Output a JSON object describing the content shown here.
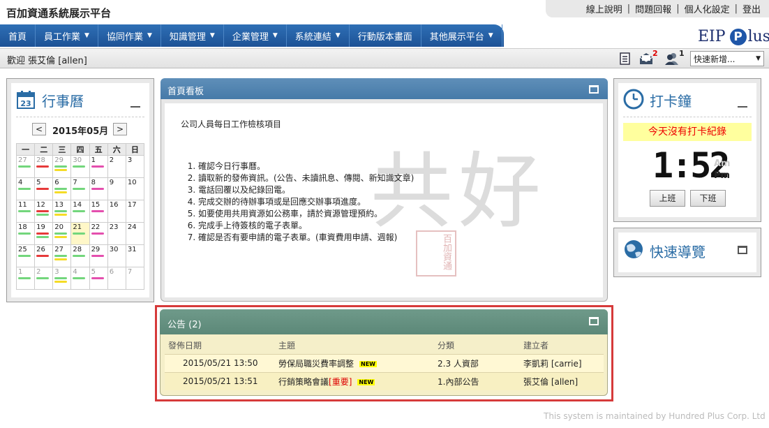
{
  "header": {
    "brand": "百加資通系統展示平台",
    "links": [
      "線上說明",
      "問題回報",
      "個人化設定",
      "登出"
    ]
  },
  "nav": [
    {
      "label": "首頁",
      "dropdown": false
    },
    {
      "label": "員工作業",
      "dropdown": true
    },
    {
      "label": "協同作業",
      "dropdown": true
    },
    {
      "label": "知識管理",
      "dropdown": true
    },
    {
      "label": "企業管理",
      "dropdown": true
    },
    {
      "label": "系統連結",
      "dropdown": true
    },
    {
      "label": "行動版本畫面",
      "dropdown": false
    },
    {
      "label": "其他展示平台",
      "dropdown": true
    }
  ],
  "logo": {
    "left": "EIP",
    "mid": "P",
    "right": "lus"
  },
  "toolbar": {
    "welcome": "歡迎 張艾倫 [allen]",
    "mail_count": "2",
    "user_count": "1",
    "quick_add": "快速新增...",
    "quick_caret": "▼"
  },
  "calendar": {
    "title": "行事曆",
    "month": "2015年05月",
    "prev": "<",
    "next": ">",
    "weekdays": [
      "一",
      "二",
      "三",
      "四",
      "五",
      "六",
      "日"
    ],
    "weeks": [
      [
        {
          "d": "27",
          "o": true,
          "b": [
            "g"
          ]
        },
        {
          "d": "28",
          "o": true,
          "b": [
            "r"
          ]
        },
        {
          "d": "29",
          "o": true,
          "b": [
            "g",
            "y"
          ]
        },
        {
          "d": "30",
          "o": true,
          "b": [
            "g"
          ]
        },
        {
          "d": "1",
          "b": [
            "m"
          ]
        },
        {
          "d": "2",
          "b": []
        },
        {
          "d": "3",
          "b": []
        }
      ],
      [
        {
          "d": "4",
          "b": [
            "g"
          ]
        },
        {
          "d": "5",
          "b": [
            "r"
          ]
        },
        {
          "d": "6",
          "b": [
            "g",
            "y"
          ]
        },
        {
          "d": "7",
          "b": [
            "g"
          ]
        },
        {
          "d": "8",
          "b": [
            "m"
          ]
        },
        {
          "d": "9",
          "b": []
        },
        {
          "d": "10",
          "b": []
        }
      ],
      [
        {
          "d": "11",
          "b": [
            "g"
          ]
        },
        {
          "d": "12",
          "b": [
            "r",
            "g"
          ]
        },
        {
          "d": "13",
          "b": [
            "g",
            "y"
          ]
        },
        {
          "d": "14",
          "b": [
            "g"
          ]
        },
        {
          "d": "15",
          "b": [
            "m"
          ]
        },
        {
          "d": "16",
          "b": []
        },
        {
          "d": "17",
          "b": []
        }
      ],
      [
        {
          "d": "18",
          "b": [
            "g"
          ]
        },
        {
          "d": "19",
          "b": [
            "r",
            "g"
          ]
        },
        {
          "d": "20",
          "b": [
            "g",
            "y"
          ]
        },
        {
          "d": "21",
          "t": true,
          "b": [
            "g"
          ]
        },
        {
          "d": "22",
          "b": [
            "m"
          ]
        },
        {
          "d": "23",
          "b": []
        },
        {
          "d": "24",
          "b": []
        }
      ],
      [
        {
          "d": "25",
          "b": [
            "g"
          ]
        },
        {
          "d": "26",
          "b": [
            "r"
          ]
        },
        {
          "d": "27",
          "b": [
            "g",
            "y"
          ]
        },
        {
          "d": "28",
          "b": [
            "g"
          ]
        },
        {
          "d": "29",
          "b": [
            "m"
          ]
        },
        {
          "d": "30",
          "b": []
        },
        {
          "d": "31",
          "b": []
        }
      ],
      [
        {
          "d": "1",
          "o": true,
          "b": [
            "g"
          ]
        },
        {
          "d": "2",
          "o": true,
          "b": [
            "g"
          ]
        },
        {
          "d": "3",
          "o": true,
          "b": [
            "g",
            "y"
          ]
        },
        {
          "d": "4",
          "o": true,
          "b": [
            "g"
          ]
        },
        {
          "d": "5",
          "o": true,
          "b": [
            "m"
          ]
        },
        {
          "d": "6",
          "o": true,
          "b": []
        },
        {
          "d": "7",
          "o": true,
          "b": []
        }
      ]
    ]
  },
  "board": {
    "title": "首頁看板",
    "heading": "公司人員每日工作檢核項目",
    "items": [
      "確認今日行事曆。",
      "讀取新的發佈資訊。(公告、未讀訊息、傳閱、新知識文章)",
      "電話回覆以及紀錄回電。",
      "完成交辦的待辦事項或是回應交辦事項進度。",
      "如要使用共用資源如公務車，請於資源管理預約。",
      "完成手上待簽核的電子表單。",
      "確認是否有要申請的電子表單。(車資費用申請、週報)"
    ],
    "calligraphy": "共好",
    "seal": "百加資通"
  },
  "announcements": {
    "title": "公告 (2)",
    "columns": [
      "發佈日期",
      "主題",
      "分類",
      "建立者"
    ],
    "rows": [
      {
        "date": "2015/05/21 13:50",
        "subject": "勞保局職災費率調整",
        "important": "",
        "tag": "NEW",
        "category": "2.3 人資部",
        "author": "李凱莉 [carrie]"
      },
      {
        "date": "2015/05/21 13:51",
        "subject": "行銷策略會議",
        "important": "[重要]",
        "tag": "NEW",
        "category": "1.內部公告",
        "author": "張艾倫 [allen]"
      }
    ]
  },
  "punch": {
    "title": "打卡鐘",
    "message": "今天沒有打卡紀錄",
    "time": "1:52",
    "am": "Am",
    "pm": "Pm",
    "clock_in": "上班",
    "clock_out": "下班"
  },
  "quicknav": {
    "title": "快速導覽"
  },
  "calendar_icon_day": "23",
  "footer": "This system is maintained by Hundred Plus Corp. Ltd"
}
